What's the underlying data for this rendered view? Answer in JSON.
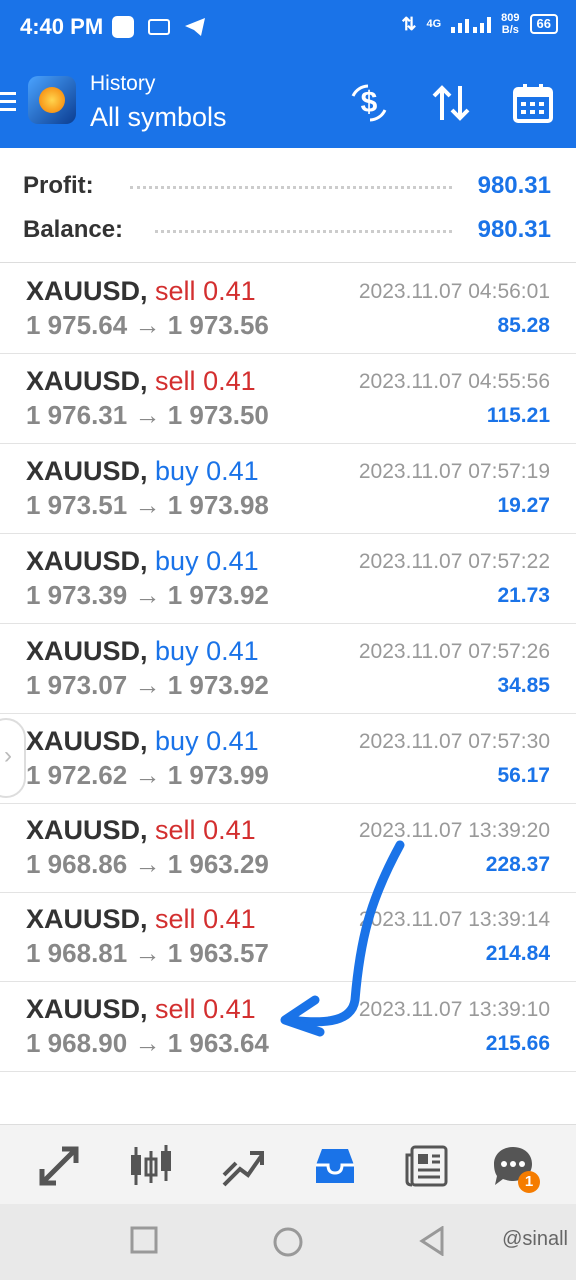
{
  "status_bar": {
    "time": "4:40 PM",
    "network": "4G",
    "speed_value": "809",
    "speed_unit": "B/s",
    "battery": "66"
  },
  "app_bar": {
    "title": "History",
    "subtitle": "All symbols",
    "icons": [
      "menu-icon",
      "metatrader-logo",
      "deposit-dollar-icon",
      "sort-arrows-icon",
      "calendar-icon"
    ]
  },
  "summary": {
    "profit_label": "Profit:",
    "profit_value": "980.31",
    "balance_label": "Balance:",
    "balance_value": "980.31"
  },
  "trades": [
    {
      "symbol": "XAUUSD,",
      "side": "sell",
      "lot": "0.41",
      "open": "1 975.64",
      "close": "1 973.56",
      "time": "2023.11.07 04:56:01",
      "profit": "85.28"
    },
    {
      "symbol": "XAUUSD,",
      "side": "sell",
      "lot": "0.41",
      "open": "1 976.31",
      "close": "1 973.50",
      "time": "2023.11.07 04:55:56",
      "profit": "115.21"
    },
    {
      "symbol": "XAUUSD,",
      "side": "buy",
      "lot": "0.41",
      "open": "1 973.51",
      "close": "1 973.98",
      "time": "2023.11.07 07:57:19",
      "profit": "19.27"
    },
    {
      "symbol": "XAUUSD,",
      "side": "buy",
      "lot": "0.41",
      "open": "1 973.39",
      "close": "1 973.92",
      "time": "2023.11.07 07:57:22",
      "profit": "21.73"
    },
    {
      "symbol": "XAUUSD,",
      "side": "buy",
      "lot": "0.41",
      "open": "1 973.07",
      "close": "1 973.92",
      "time": "2023.11.07 07:57:26",
      "profit": "34.85"
    },
    {
      "symbol": "XAUUSD,",
      "side": "buy",
      "lot": "0.41",
      "open": "1 972.62",
      "close": "1 973.99",
      "time": "2023.11.07 07:57:30",
      "profit": "56.17"
    },
    {
      "symbol": "XAUUSD,",
      "side": "sell",
      "lot": "0.41",
      "open": "1 968.86",
      "close": "1 963.29",
      "time": "2023.11.07 13:39:20",
      "profit": "228.37"
    },
    {
      "symbol": "XAUUSD,",
      "side": "sell",
      "lot": "0.41",
      "open": "1 968.81",
      "close": "1 963.57",
      "time": "2023.11.07 13:39:14",
      "profit": "214.84"
    },
    {
      "symbol": "XAUUSD,",
      "side": "sell",
      "lot": "0.41",
      "open": "1 968.90",
      "close": "1 963.64",
      "time": "2023.11.07 13:39:10",
      "profit": "215.66"
    }
  ],
  "price_arrow": "→",
  "bottom_nav": {
    "items": [
      "quotes-icon",
      "chart-icon",
      "trade-icon",
      "history-icon",
      "news-icon",
      "chat-icon"
    ],
    "chat_badge": "1",
    "active_item": "history-icon"
  },
  "watermark": "@sinall"
}
